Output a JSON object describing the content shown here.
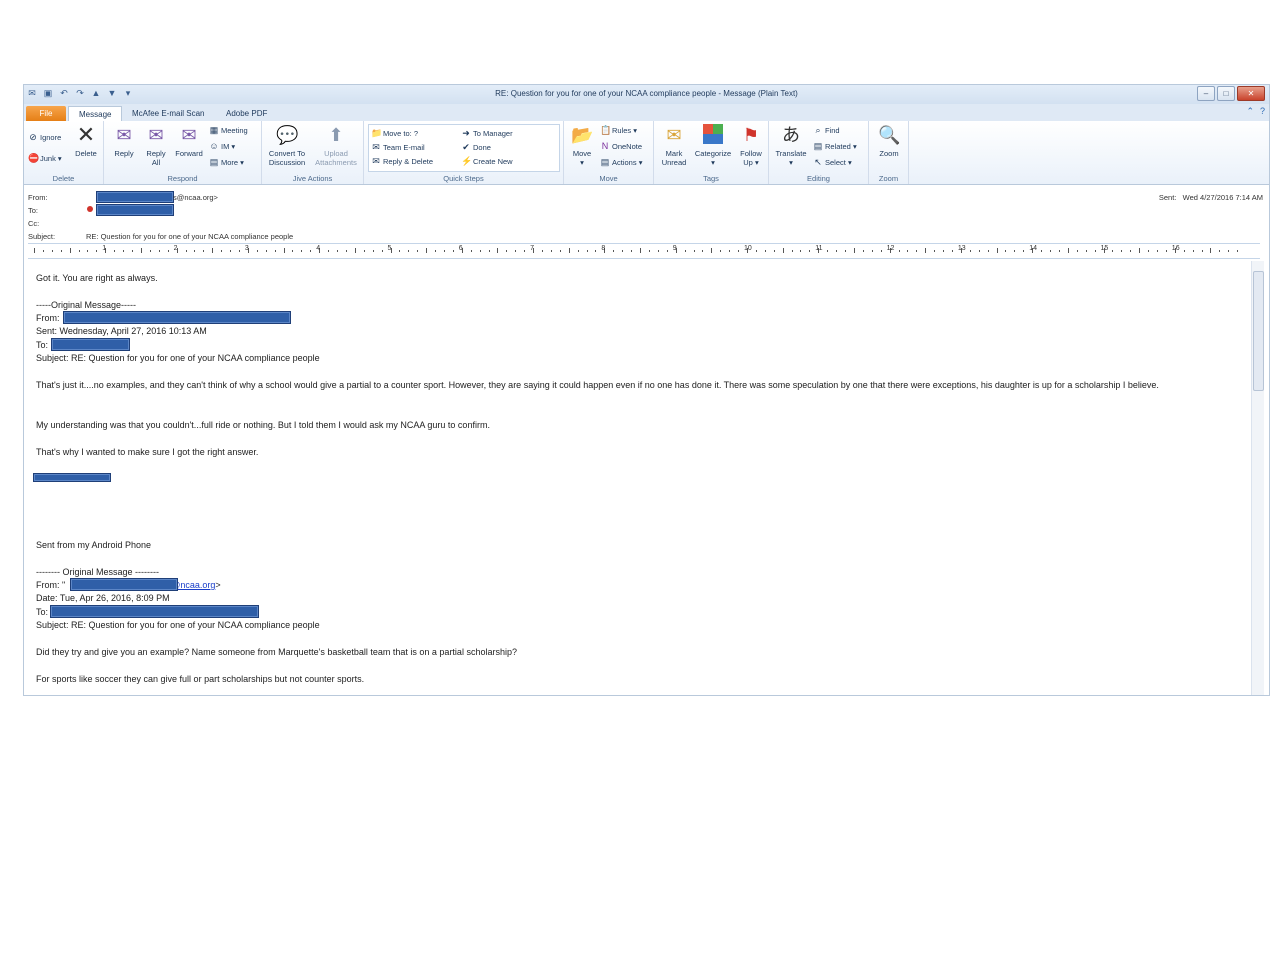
{
  "window": {
    "title": "RE: Question for you for one of your NCAA compliance people  -  Message (Plain Text)"
  },
  "tabs": [
    "File",
    "Message",
    "McAfee E-mail Scan",
    "Adobe PDF"
  ],
  "ribbon": {
    "delete_group": {
      "label": "Delete",
      "ignore": "Ignore",
      "junk": "Junk",
      "delete": "Delete"
    },
    "respond_group": {
      "label": "Respond",
      "reply": "Reply",
      "reply_all_1": "Reply",
      "reply_all_2": "All",
      "forward": "Forward",
      "meeting": "Meeting",
      "im": "IM",
      "more": "More"
    },
    "jive_group": {
      "label": "Jive Actions",
      "convert_1": "Convert To",
      "convert_2": "Discussion",
      "upload_1": "Upload",
      "upload_2": "Attachments"
    },
    "quicksteps_group": {
      "label": "Quick Steps",
      "move_to": "Move to: ?",
      "team_email": "Team E-mail",
      "reply_delete": "Reply & Delete",
      "to_manager": "To Manager",
      "done": "Done",
      "create_new": "Create New"
    },
    "move_group": {
      "label": "Move",
      "move": "Move",
      "rules": "Rules",
      "onenote": "OneNote",
      "actions": "Actions"
    },
    "tags_group": {
      "label": "Tags",
      "mark_unread_1": "Mark",
      "mark_unread_2": "Unread",
      "categorize": "Categorize",
      "follow_up_1": "Follow",
      "follow_up_2": "Up"
    },
    "editing_group": {
      "label": "Editing",
      "translate": "Translate",
      "find": "Find",
      "related": "Related",
      "select": "Select"
    },
    "zoom_group": {
      "label": "Zoom",
      "zoom": "Zoom"
    }
  },
  "header": {
    "from_label": "From:",
    "from_suffix": "s@ncaa.org>",
    "to_label": "To:",
    "cc_label": "Cc:",
    "subject_label": "Subject:",
    "subject": "RE: Question for you for one of your NCAA compliance people",
    "sent_label": "Sent:",
    "sent_value": "Wed 4/27/2016 7:14 AM"
  },
  "ruler_numbers": [
    "1",
    "2",
    "3",
    "4",
    "5",
    "6",
    "7",
    "8",
    "9",
    "10",
    "11",
    "12",
    "13",
    "14",
    "15",
    "16"
  ],
  "body": {
    "reply": "Got it. You are right as always.",
    "orig1_header": "-----Original Message-----",
    "orig1_from": "From:",
    "orig1_sent": "Sent: Wednesday, April 27, 2016 10:13 AM",
    "orig1_to": "To:",
    "orig1_subject": "Subject: RE: Question for you for one of your NCAA compliance people",
    "para1": "That's just it....no examples, and they can't think of why a school would give a partial to a counter sport. However, they are saying it could happen even if no one has done it. There was some speculation by one that there were exceptions, his daughter is up for a scholarship I believe.",
    "para2": "My understanding was that you couldn't...full ride or nothing. But I told them I would ask my NCAA guru to confirm.",
    "para3": "That's why I wanted to make sure I got the right answer.",
    "android": "Sent from my Android Phone",
    "orig2_header": "-------- Original Message --------",
    "orig2_from_prefix": "From: \"",
    "orig2_from_link": "@ncaa.org",
    "orig2_from_suffix": ">",
    "orig2_date": "Date: Tue, Apr 26, 2016, 8:09 PM",
    "orig2_to": "To:",
    "orig2_subject": "Subject: RE: Question for you for one of your NCAA compliance people",
    "para4": "Did they try and give you an example? Name someone from Marquette's basketball team that is on a partial scholarship?",
    "para5": "For sports like soccer they can give full or part scholarships but not counter sports."
  }
}
